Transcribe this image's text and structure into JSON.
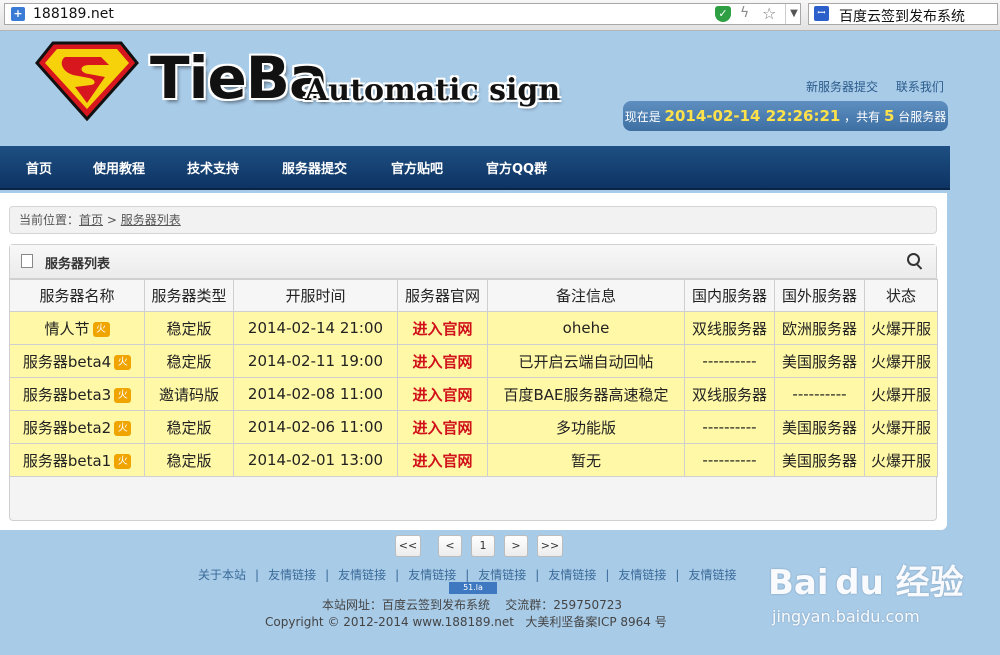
{
  "browser": {
    "url": "188189.net",
    "search_engine_label": "百度云签到发布系统",
    "icons": [
      "site-icon",
      "shield-icon",
      "bolt-icon",
      "star-icon",
      "chevron-down-icon",
      "paw-icon"
    ]
  },
  "header": {
    "logo_word": "TieBa",
    "logo_sub": "Automatic sign",
    "top_links": [
      "新服务器提交",
      "联系我们"
    ],
    "status": {
      "prefix": "现在是",
      "datetime": "2014-02-14 22:26:21",
      "middle": "，共有",
      "count": "5",
      "suffix": "台服务器"
    }
  },
  "nav": {
    "items": [
      "首页",
      "使用教程",
      "技术支持",
      "服务器提交",
      "官方贴吧",
      "官方QQ群"
    ]
  },
  "breadcrumb": {
    "prefix": "当前位置：",
    "home": "首页",
    "sep": " > ",
    "current": "服务器列表"
  },
  "panel": {
    "title": "服务器列表"
  },
  "table": {
    "headers": [
      "服务器名称",
      "服务器类型",
      "开服时间",
      "服务器官网",
      "备注信息",
      "国内服务器",
      "国外服务器",
      "状态"
    ],
    "rows": [
      {
        "name": "情人节",
        "type": "稳定版",
        "time": "2014-02-14 21:00",
        "site": "进入官网",
        "note": "ohehe",
        "domestic": "双线服务器",
        "foreign": "欧洲服务器",
        "status": "火爆开服"
      },
      {
        "name": "服务器beta4",
        "type": "稳定版",
        "time": "2014-02-11 19:00",
        "site": "进入官网",
        "note": "已开启云端自动回帖",
        "domestic": "----------",
        "foreign": "美国服务器",
        "status": "火爆开服"
      },
      {
        "name": "服务器beta3",
        "type": "邀请码版",
        "time": "2014-02-08 11:00",
        "site": "进入官网",
        "note": "百度BAE服务器高速稳定",
        "domestic": "双线服务器",
        "foreign": "----------",
        "status": "火爆开服"
      },
      {
        "name": "服务器beta2",
        "type": "稳定版",
        "time": "2014-02-06 11:00",
        "site": "进入官网",
        "note": "多功能版",
        "domestic": "----------",
        "foreign": "美国服务器",
        "status": "火爆开服"
      },
      {
        "name": "服务器beta1",
        "type": "稳定版",
        "time": "2014-02-01 13:00",
        "site": "进入官网",
        "note": "暂无",
        "domestic": "----------",
        "foreign": "美国服务器",
        "status": "火爆开服"
      }
    ]
  },
  "pager": {
    "first": "<<",
    "prev": "<",
    "page": "1",
    "next": ">",
    "last": ">>"
  },
  "footer": {
    "links": [
      "关于本站",
      "友情链接",
      "友情链接",
      "友情链接",
      "友情链接",
      "友情链接",
      "友情链接",
      "友情链接"
    ],
    "separator": "|",
    "stats_badge": "51.la",
    "site_line": "本站网址：百度云签到发布系统",
    "group_line": "交流群：259750723",
    "copyright": "Copyright © 2012-2014 www.188189.net",
    "icp": "大美利坚备案ICP 8964 号"
  },
  "watermark": {
    "brand": "Bai du 经验",
    "url": "jingyan.baidu.com"
  },
  "colors": {
    "nav_bg": "#0e3463",
    "row_bg": "#fff8a6",
    "link_red": "#d0101a",
    "status_highlight": "#ffe14a",
    "page_bg": "#a8cbe8"
  }
}
